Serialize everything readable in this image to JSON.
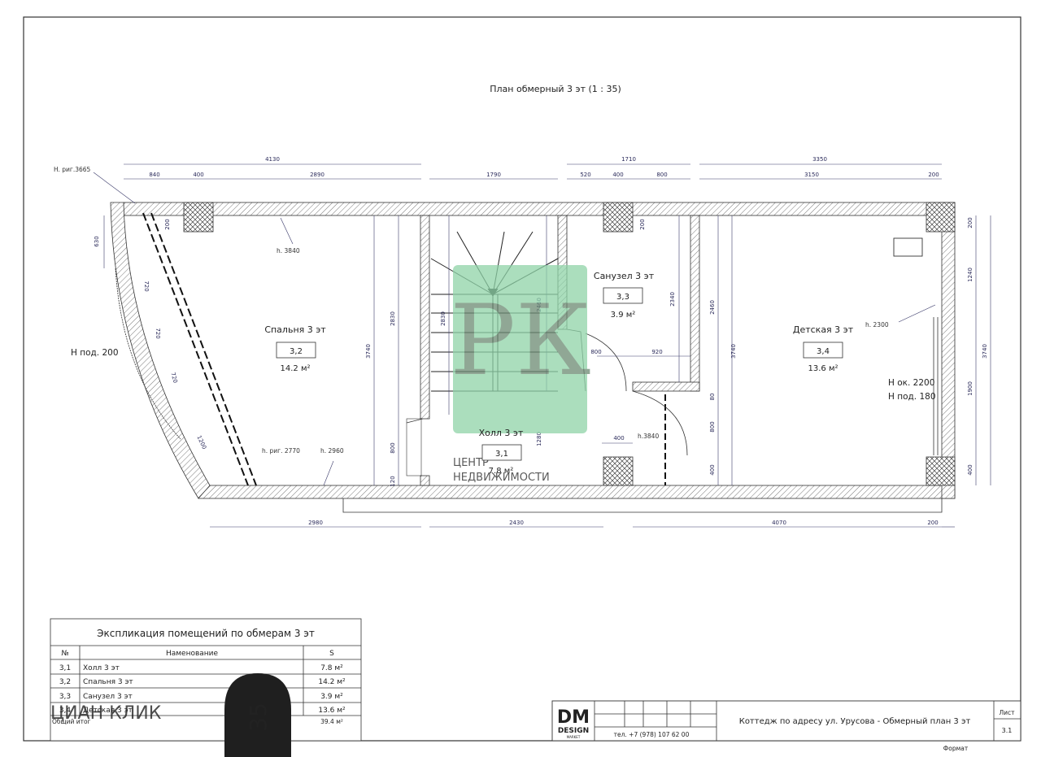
{
  "plan_title": "План обмерный 3 эт (1 : 35)",
  "rooms": [
    {
      "name": "Спальня 3 эт",
      "no": "3,2",
      "area": "14.2 м²"
    },
    {
      "name": "Холл 3 эт",
      "no": "3,1",
      "area": "7.8 м²"
    },
    {
      "name": "Санузел 3 эт",
      "no": "3,3",
      "area": "3.9 м²"
    },
    {
      "name": "Детская 3 эт",
      "no": "3,4",
      "area": "13.6 м²"
    }
  ],
  "labels": {
    "h_floor_left": "H под. 200",
    "h_window": "H ок. 2200",
    "h_floor_right": "H под. 180",
    "h_rig_top": "H. риг.3665",
    "h_3840": "h. 3840",
    "h_rig_bottom": "h. риг. 2770",
    "h_2960": "h. 2960",
    "h_2300": "h. 2300",
    "h_3840b": "h.3840"
  },
  "dims_top": {
    "d4130": "4130",
    "d1710": "1710",
    "d3350": "3350",
    "d840": "840",
    "d400a": "400",
    "d2890": "2890",
    "d1790": "1790",
    "d520": "520",
    "d400b": "400",
    "d800": "800",
    "d3150": "3150",
    "d200": "200"
  },
  "dims_bottom": {
    "d2980": "2980",
    "d2430": "2430",
    "d4070": "4070",
    "d200": "200"
  },
  "dims_inner": {
    "d630": "630",
    "d200l": "200",
    "d720a": "720",
    "d720b": "720",
    "d720c": "720",
    "d1200": "1200",
    "d3740a": "3740",
    "d2830a": "2830",
    "d800a": "800",
    "d120": "120",
    "d2830b": "2830",
    "d2460a": "2460",
    "d1280": "1280",
    "d200s": "200",
    "d2340": "2340",
    "d800s": "800",
    "d920": "920",
    "d400s": "400",
    "d2460b": "2460",
    "d3740b": "3740",
    "d80": "80",
    "d800c": "800",
    "d400c": "400",
    "d200r1": "200",
    "d1240": "1240",
    "d1900": "1900",
    "d400r": "400",
    "d3740c": "3740"
  },
  "watermark": {
    "letters": "РК",
    "line1": "ЦЕНТР",
    "line2": "НЕДВИЖИМОСТИ"
  },
  "explication": {
    "title": "Экспликация помещений по обмерам 3 эт",
    "headers": [
      "№",
      "Наменование",
      "S"
    ],
    "rows": [
      [
        "3,1",
        "Холл 3 эт",
        "7.8 м²"
      ],
      [
        "3,2",
        "Спальня 3 эт",
        "14.2 м²"
      ],
      [
        "3,3",
        "Санузел 3 эт",
        "3.9 м²"
      ],
      [
        "3,4",
        "Детская 3 эт",
        "13.6 м²"
      ]
    ],
    "total_label": "Общий итог",
    "total_value": "39.4 м²"
  },
  "stamp": {
    "logo_main": "DM",
    "logo_sub": "DESIGN",
    "logo_sub2": "MARKET",
    "phone": "тел. +7 (978) 107 62 00",
    "title": "Коттедж по адресу ул. Урусова - Обмерный план 3 эт",
    "sheet_label": "Лист",
    "sheet_no": "3.1",
    "format_label": "Формат"
  },
  "overlay": {
    "watermark_text": "ЦИАН КЛИК",
    "badge": "35"
  }
}
